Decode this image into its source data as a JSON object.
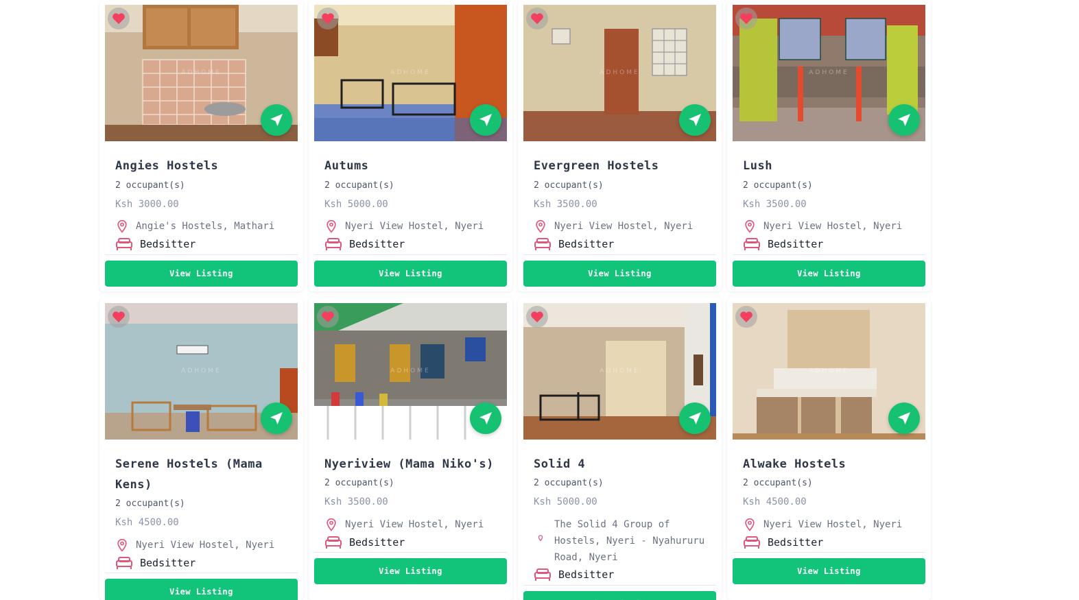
{
  "brand_watermark": "ADHOME",
  "view_button_label": "View Listing",
  "colors": {
    "accent": "#12c47a",
    "heart": "#f43f5e",
    "pin": "#e0557a"
  },
  "listings": [
    {
      "name": "Angies Hostels",
      "occupants": "2 occupant(s)",
      "price": "Ksh 3000.00",
      "location": "Angie's Hostels, Mathari",
      "type": "Bedsitter"
    },
    {
      "name": "Autums",
      "occupants": "2 occupant(s)",
      "price": "Ksh 5000.00",
      "location": "Nyeri View Hostel, Nyeri",
      "type": "Bedsitter"
    },
    {
      "name": "Evergreen Hostels",
      "occupants": "2 occupant(s)",
      "price": "Ksh 3500.00",
      "location": "Nyeri View Hostel, Nyeri",
      "type": "Bedsitter"
    },
    {
      "name": "Lush",
      "occupants": "2 occupant(s)",
      "price": "Ksh 3500.00",
      "location": "Nyeri View Hostel, Nyeri",
      "type": "Bedsitter"
    },
    {
      "name": "Serene Hostels (Mama Kens)",
      "occupants": "2 occupant(s)",
      "price": "Ksh 4500.00",
      "location": "Nyeri View Hostel, Nyeri",
      "type": "Bedsitter"
    },
    {
      "name": "Nyeriview (Mama Niko's)",
      "occupants": "2 occupant(s)",
      "price": "Ksh 3500.00",
      "location": "Nyeri View Hostel, Nyeri",
      "type": "Bedsitter"
    },
    {
      "name": "Solid 4",
      "occupants": "2 occupant(s)",
      "price": "Ksh 5000.00",
      "location": "The Solid 4 Group of Hostels, Nyeri - Nyahururu Road, Nyeri",
      "type": "Bedsitter"
    },
    {
      "name": "Alwake Hostels",
      "occupants": "2 occupant(s)",
      "price": "Ksh 4500.00",
      "location": "Nyeri View Hostel, Nyeri",
      "type": "Bedsitter"
    }
  ]
}
